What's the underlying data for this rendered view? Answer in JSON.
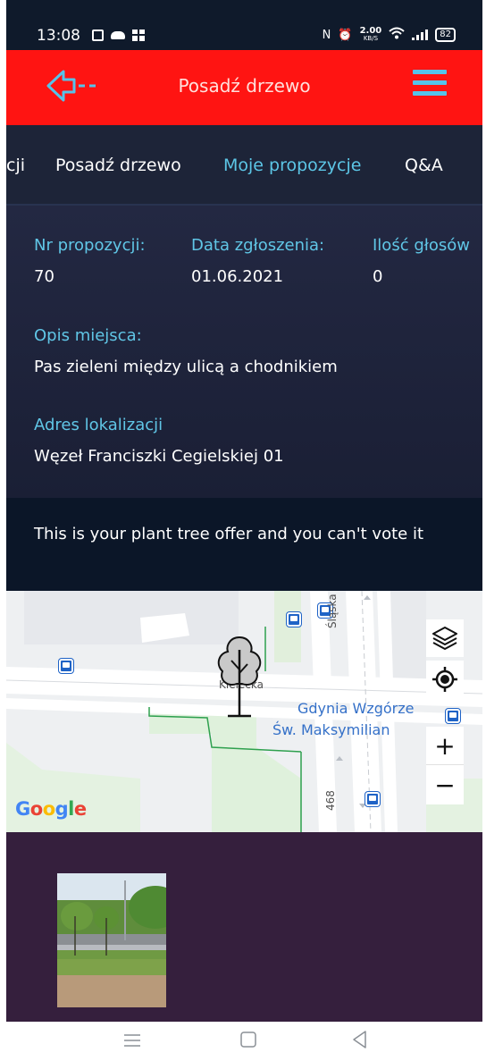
{
  "status_bar": {
    "time": "13:08",
    "net_speed": "2.00",
    "net_unit": "KB/S",
    "battery": "82"
  },
  "header": {
    "title": "Posadź drzewo",
    "accent_color": "#ff1412",
    "icon_color": "#56c3ea"
  },
  "tabs": [
    {
      "label": "cji",
      "active": false
    },
    {
      "label": "Posadź drzewo",
      "active": false
    },
    {
      "label": "Moje propozycje",
      "active": true
    },
    {
      "label": "Q&A",
      "active": false
    }
  ],
  "proposal": {
    "number_label": "Nr propozycji:",
    "number_value": "70",
    "date_label": "Data zgłoszenia:",
    "date_value": "01.06.2021",
    "votes_label": "Ilość głosów",
    "votes_value": "0",
    "place_label": "Opis miejsca:",
    "place_value": "Pas zieleni między ulicą a chodnikiem",
    "address_label": "Adres lokalizacji",
    "address_value": "Węzeł Franciszki Cegielskiej 01"
  },
  "notice": {
    "text": "This is your plant tree offer and you can't vote it"
  },
  "map": {
    "place_line1": "Gdynia Wzgórze",
    "place_line2": "Św. Maksymilian",
    "street_1": "Śląska",
    "street_2": "Kielecka",
    "street_3": "468",
    "zoom_in": "+",
    "zoom_out": "−",
    "logo": "Google",
    "icons": [
      "layers-icon",
      "my-location-icon",
      "tree-marker-icon",
      "bus-stop-icon"
    ]
  },
  "photos": {
    "count": 1
  },
  "nav": {
    "icons": [
      "recents-icon",
      "home-icon",
      "back-icon"
    ]
  }
}
